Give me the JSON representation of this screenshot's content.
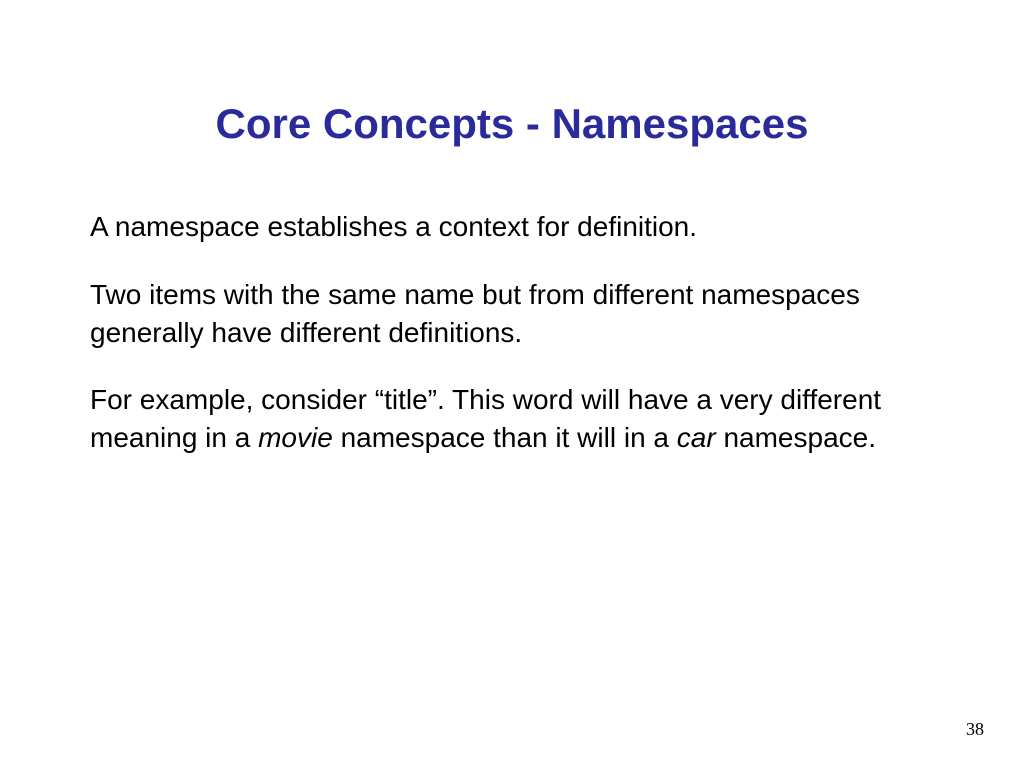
{
  "slide": {
    "title": "Core Concepts - Namespaces",
    "paragraphs": {
      "p1": "A namespace establishes a context for definition.",
      "p2": "Two items with the same name but from different namespaces generally have different definitions.",
      "p3_part1": "For example, consider “title”.  This word will have a very different meaning in a ",
      "p3_italic1": "movie",
      "p3_part2": " namespace than it will in a ",
      "p3_italic2": "car",
      "p3_part3": " namespace."
    },
    "page_number": "38"
  }
}
